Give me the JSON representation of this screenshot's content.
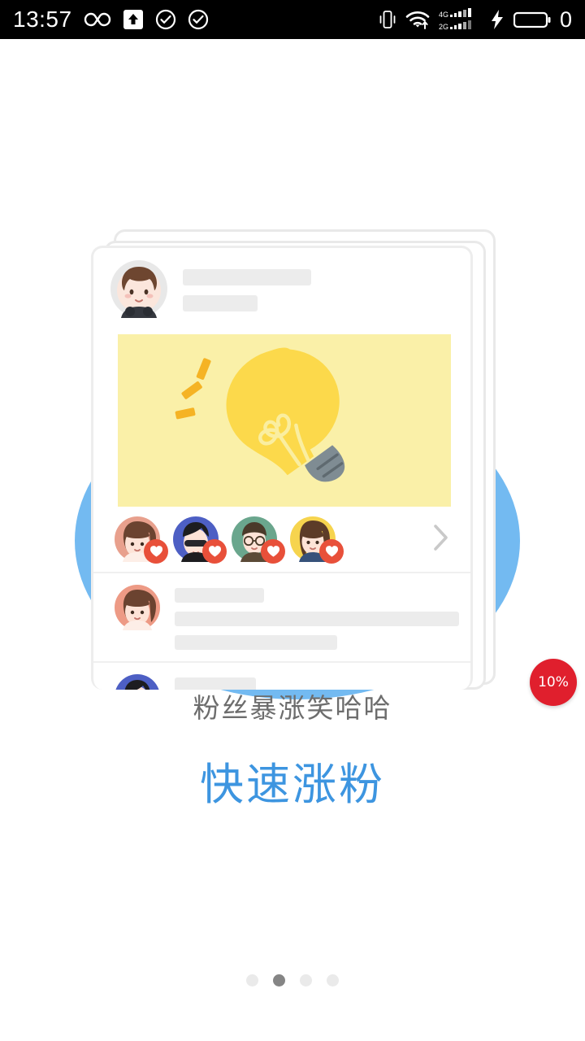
{
  "status_bar": {
    "time": "13:57",
    "battery_text": "0",
    "left_icons": [
      "infinity-icon",
      "upload-badge-icon",
      "check-circle-icon",
      "check-circle-icon"
    ],
    "right_icons": [
      "vibrate-icon",
      "wifi-icon",
      "signal-4g-icon",
      "signal-2g-icon",
      "charging-bolt-icon",
      "battery-icon"
    ],
    "signal_labels": {
      "sim1": "4G",
      "sim2": "2G"
    },
    "background": "#000000",
    "foreground": "#ffffff"
  },
  "illustration": {
    "blue_circle_color": "#6cb6f0",
    "banner_background": "#faf0a8",
    "bulb_color": "#fcd94b",
    "bulb_base_color": "#7f8c93",
    "spark_color": "#f5b324",
    "card_background": "#ffffff",
    "placeholder_color": "#ececec",
    "heart_badge_color": "#e8503a",
    "post_author_avatar": "avatar-boy-brown-hair",
    "header_placeholders": [
      {
        "name": "author-name-placeholder"
      },
      {
        "name": "author-meta-placeholder"
      }
    ],
    "likers": [
      {
        "name": "avatar-girl-pink",
        "bg": "#e8a08d",
        "badge": "heart-icon"
      },
      {
        "name": "avatar-man-sunglasses",
        "bg": "#4d5fc4",
        "badge": "heart-icon"
      },
      {
        "name": "avatar-man-glasses-green",
        "bg": "#6aa68d",
        "badge": "heart-icon"
      },
      {
        "name": "avatar-girl-yellow",
        "bg": "#f6d44e",
        "badge": "heart-icon"
      }
    ],
    "likes_more_icon": "chevron-right-icon",
    "comments": [
      {
        "avatar": "avatar-girl-pink",
        "bg": "#ed9a85",
        "bars": [
          110,
          350,
          200
        ]
      },
      {
        "avatar": "avatar-man-sunglasses",
        "bg": "#4d5fc4",
        "bars": [
          100,
          270
        ]
      }
    ]
  },
  "progress_badge": {
    "label": "10%",
    "color": "#e01f2d"
  },
  "captions": {
    "subtitle": "粉丝暴涨笑哈哈",
    "headline": "快速涨粉",
    "subtitle_color": "#6d6d6d",
    "headline_color": "#3d95e0"
  },
  "pagination": {
    "total": 4,
    "active_index": 1,
    "active_color": "#858585",
    "inactive_color": "#eaeaea"
  }
}
